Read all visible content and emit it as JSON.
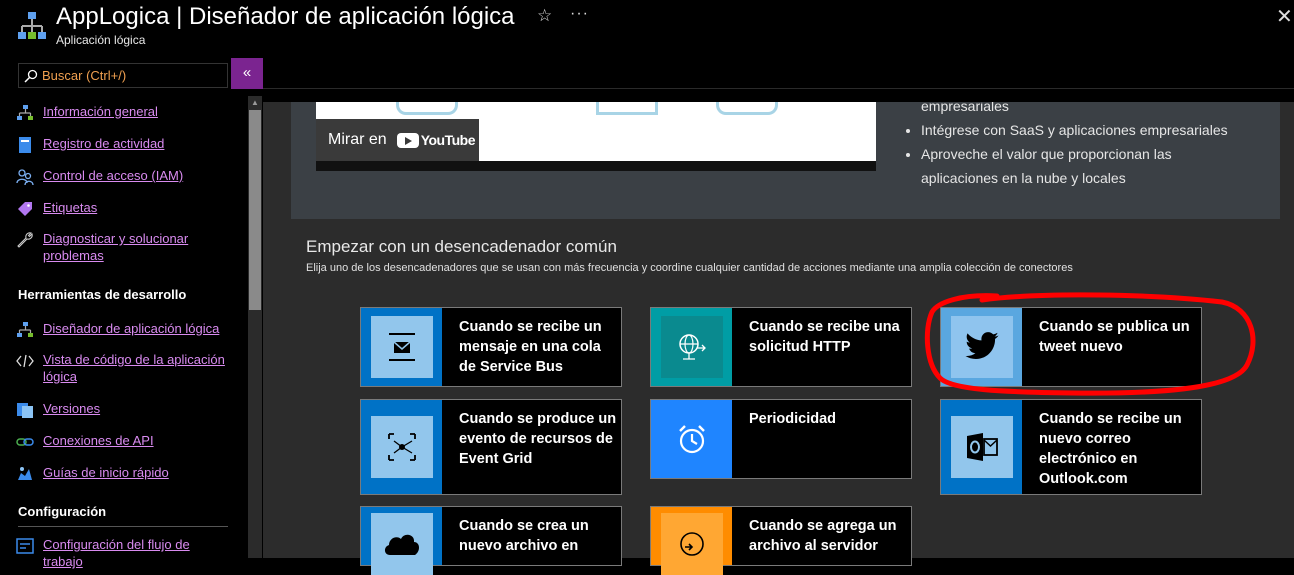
{
  "header": {
    "title": "AppLogica | Diseñador de aplicación lógica",
    "subtitle": "Aplicación lógica",
    "icons": [
      "logic-app-icon",
      "star-icon",
      "more-icon",
      "close-icon"
    ]
  },
  "search": {
    "placeholder": "Buscar (Ctrl+/)",
    "collapse_label": "«"
  },
  "nav": {
    "items": [
      {
        "label": "Información general",
        "icon": "overview-icon"
      },
      {
        "label": "Registro de actividad",
        "icon": "activity-log-icon"
      },
      {
        "label": "Control de acceso (IAM)",
        "icon": "access-control-icon"
      },
      {
        "label": "Etiquetas",
        "icon": "tag-icon"
      },
      {
        "label": "Diagnosticar y solucionar problemas",
        "icon": "wrench-icon"
      }
    ],
    "dev_tools_title": "Herramientas de desarrollo",
    "dev_tools": [
      {
        "label": "Diseñador de aplicación lógica",
        "icon": "designer-icon"
      },
      {
        "label": "Vista de código de la aplicación lógica",
        "icon": "code-icon"
      },
      {
        "label": "Versiones",
        "icon": "versions-icon"
      },
      {
        "label": "Conexiones de API",
        "icon": "api-connections-icon"
      },
      {
        "label": "Guías de inicio rápido",
        "icon": "quickstart-icon"
      }
    ],
    "config_title": "Configuración",
    "config": [
      {
        "label": "Configuración del flujo de trabajo",
        "icon": "workflow-settings-icon"
      }
    ]
  },
  "hero": {
    "watch_label": "Mirar en",
    "youtube_label": "YouTube",
    "bullets": [
      "empresariales",
      "Intégrese con SaaS y aplicaciones empresariales",
      "Aproveche el valor que proporcionan las",
      "aplicaciones en la nube y locales"
    ]
  },
  "triggers": {
    "title": "Empezar con un desencadenador común",
    "description": "Elija uno de los desencadenadores que se usan con más frecuencia y coordine cualquier cantidad de acciones mediante una amplia colección de conectores",
    "cards": [
      {
        "label": "Cuando se recibe un mensaje en una cola de Service Bus",
        "icon": "service-bus-icon",
        "color": "#0072c6",
        "inner": "#92c6ec"
      },
      {
        "label": "Cuando se recibe una solicitud HTTP",
        "icon": "http-request-icon",
        "color": "#009da5",
        "inner": "#0a8a8f"
      },
      {
        "label": "Cuando se publica un tweet nuevo",
        "icon": "twitter-icon",
        "color": "#5aa7e0",
        "inner": "#8fc4ee"
      },
      {
        "label": "Cuando se produce un evento de recursos de Event Grid",
        "icon": "event-grid-icon",
        "color": "#0072c6",
        "inner": "#92c6ec"
      },
      {
        "label": "Periodicidad",
        "icon": "clock-icon",
        "color": "#1f85ff",
        "inner": "#1f85ff"
      },
      {
        "label": "Cuando se recibe un nuevo correo electrónico en Outlook.com",
        "icon": "outlook-icon",
        "color": "#0072c6",
        "inner": "#92c6ec"
      },
      {
        "label": "Cuando se crea un nuevo archivo en",
        "icon": "cloud-icon",
        "color": "#0072c6",
        "inner": "#92c6ec"
      },
      {
        "label": "Cuando se agrega un archivo al servidor",
        "icon": "ftp-icon",
        "color": "#ff8c00",
        "inner": "#ffa733"
      }
    ]
  },
  "highlight_color": "#ff0000"
}
